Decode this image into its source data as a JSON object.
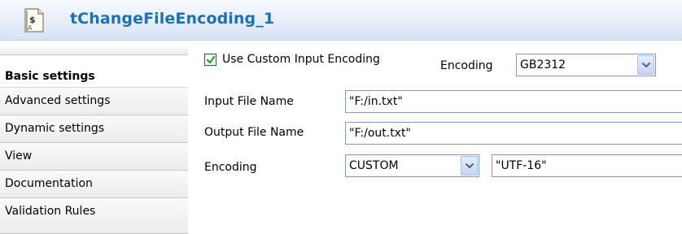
{
  "header": {
    "title": "tChangeFileEncoding_1",
    "icon": "component-icon"
  },
  "sidebar": {
    "tabs": [
      {
        "label": "Basic settings",
        "active": true
      },
      {
        "label": "Advanced settings",
        "active": false
      },
      {
        "label": "Dynamic settings",
        "active": false
      },
      {
        "label": "View",
        "active": false
      },
      {
        "label": "Documentation",
        "active": false
      },
      {
        "label": "Validation Rules",
        "active": false
      }
    ]
  },
  "basic_settings": {
    "use_custom_input_encoding": {
      "label": "Use Custom Input Encoding",
      "checked": true
    },
    "input_encoding": {
      "label": "Encoding",
      "value": "GB2312"
    },
    "input_file_name": {
      "label": "Input File Name",
      "value": "\"F:/in.txt\""
    },
    "output_file_name": {
      "label": "Output File Name",
      "value": "\"F:/out.txt\""
    },
    "output_encoding": {
      "label": "Encoding",
      "selected": "CUSTOM",
      "custom_value": "\"UTF-16\""
    }
  },
  "colors": {
    "title": "#1f6fb4",
    "field_border": "#7f9db9",
    "combo_button": "#c3d3fd"
  }
}
